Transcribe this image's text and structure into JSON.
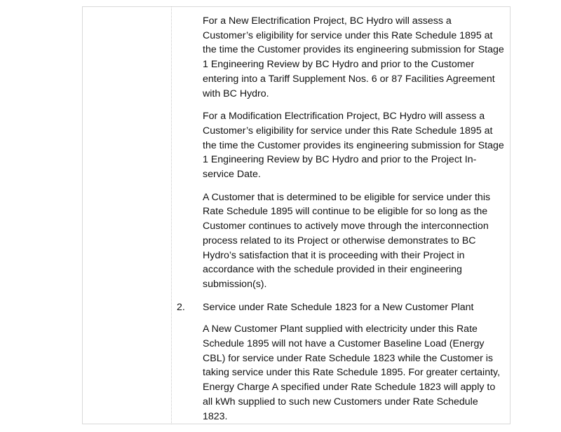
{
  "document": {
    "paragraphs_before": [
      "For a New Electrification Project, BC Hydro will assess a Customer’s eligibility for service under this Rate Schedule 1895 at the time the Customer provides its engineering submission for Stage 1 Engineering Review by BC Hydro and prior to the Customer entering into a Tariff Supplement Nos. 6 or 87 Facilities Agreement with BC Hydro.",
      "For a Modification Electrification Project, BC Hydro will assess a Customer’s eligibility for service under this Rate Schedule 1895 at the time the Customer provides its engineering submission for Stage 1 Engineering Review by BC Hydro and prior to the Project In-service Date.",
      "A Customer that is determined to be eligible for service under this Rate Schedule 1895 will continue to be eligible for so long as the Customer continues to actively move through the interconnection process related to its Project or otherwise demonstrates to BC Hydro’s satisfaction that it is proceeding with their Project in accordance with the schedule provided in their engineering submission(s)."
    ],
    "item": {
      "number": "2.",
      "heading": "Service under Rate Schedule 1823 for a New Customer Plant"
    },
    "paragraph_after": "A New Customer Plant supplied with electricity under this Rate Schedule 1895 will not have a Customer Baseline Load (Energy CBL) for service under Rate Schedule 1823 while the Customer is taking service under this Rate Schedule 1895. For greater certainty, Energy Charge A specified under Rate Schedule 1823 will apply to all kWh supplied to such new Customers under Rate Schedule 1823."
  }
}
